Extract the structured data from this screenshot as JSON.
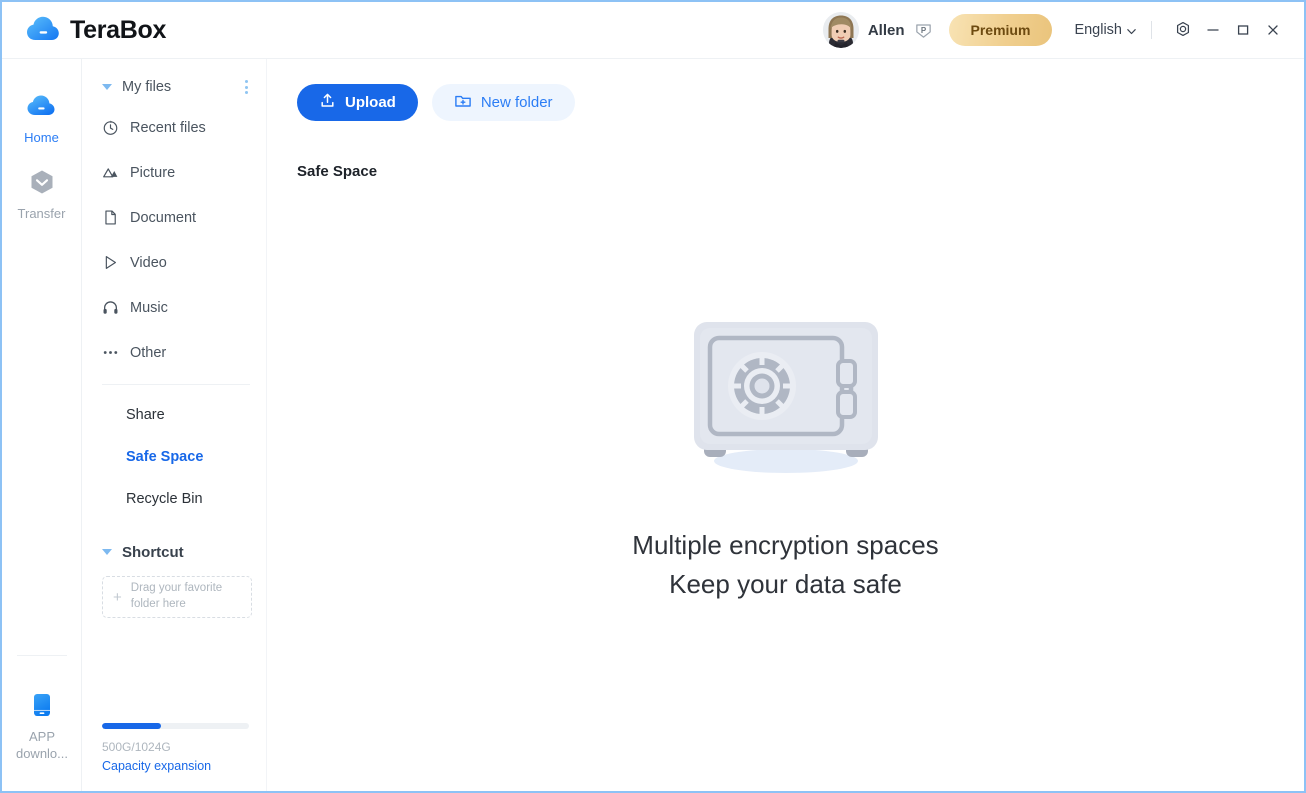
{
  "app": {
    "brand": "TeraBox",
    "brand_logo_icon": "cloud-logo-icon"
  },
  "titlebar": {
    "username": "Allen",
    "premium_badge_icon": "premium-p-badge-icon",
    "premium_label": "Premium",
    "language": "English",
    "language_chevron_icon": "chevron-down-icon",
    "settings_icon": "gear-icon",
    "minimize_icon": "minimize-icon",
    "maximize_icon": "maximize-icon",
    "close_icon": "close-icon",
    "avatar_icon": "user-avatar"
  },
  "rail": {
    "items": [
      {
        "label": "Home",
        "icon": "cloud-home-icon",
        "active": true
      },
      {
        "label": "Transfer",
        "icon": "transfer-hexagon-icon",
        "active": false
      }
    ],
    "bottom": {
      "label": "APP downlo...",
      "icon": "mobile-app-icon"
    }
  },
  "sidebar": {
    "my_files": {
      "label": "My files",
      "caret_icon": "caret-down-icon",
      "more_icon": "more-vertical-icon"
    },
    "items": [
      {
        "label": "Recent files",
        "icon": "clock-icon"
      },
      {
        "label": "Picture",
        "icon": "image-icon"
      },
      {
        "label": "Document",
        "icon": "document-icon"
      },
      {
        "label": "Video",
        "icon": "play-triangle-icon"
      },
      {
        "label": "Music",
        "icon": "headphones-icon"
      },
      {
        "label": "Other",
        "icon": "ellipsis-icon"
      }
    ],
    "sub_items": [
      {
        "label": "Share",
        "active": false
      },
      {
        "label": "Safe Space",
        "active": true
      },
      {
        "label": "Recycle Bin",
        "active": false
      }
    ],
    "shortcut": {
      "label": "Shortcut",
      "caret_icon": "caret-down-icon",
      "dropzone_plus": "+",
      "dropzone_text": "Drag your favorite folder here"
    },
    "capacity": {
      "used_total": "500G/1024G",
      "percent": 40,
      "expansion_link": "Capacity expansion"
    }
  },
  "main": {
    "upload_label": "Upload",
    "upload_icon": "upload-icon",
    "new_folder_label": "New folder",
    "new_folder_icon": "folder-plus-icon",
    "section_title": "Safe Space",
    "empty_state": {
      "illustration_icon": "safe-vault-illustration",
      "line1": "Multiple encryption spaces",
      "line2": "Keep your data safe"
    }
  },
  "colors": {
    "accent_blue": "#1868e8",
    "light_blue": "#2b7df5",
    "premium_gold": "#eac47c",
    "window_border": "#8dc2f5",
    "muted_text": "#9aa3ad"
  }
}
